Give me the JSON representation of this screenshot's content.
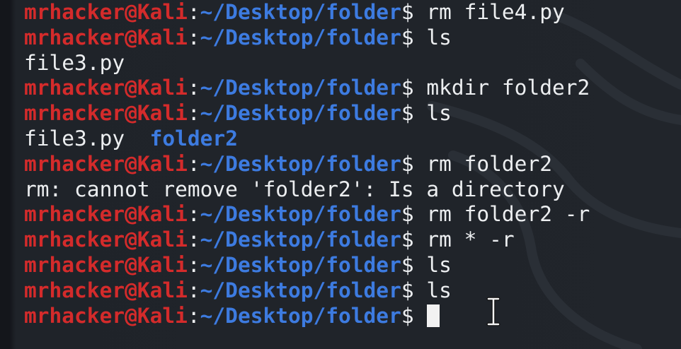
{
  "terminal": {
    "prompt": {
      "user_host": "mrhacker@Kali",
      "colon": ":",
      "path": "~/Desktop/folder",
      "dollar": "$"
    },
    "lines": [
      {
        "type": "prompt",
        "command": "rm file4.py"
      },
      {
        "type": "prompt",
        "command": "ls"
      },
      {
        "type": "output",
        "text": "file3.py"
      },
      {
        "type": "prompt",
        "command": "mkdir folder2"
      },
      {
        "type": "prompt",
        "command": "ls"
      },
      {
        "type": "listing",
        "file": "file3.py",
        "dir": "folder2"
      },
      {
        "type": "prompt",
        "command": "rm folder2"
      },
      {
        "type": "output",
        "text": "rm: cannot remove 'folder2': Is a directory"
      },
      {
        "type": "prompt",
        "command": "rm folder2 -r"
      },
      {
        "type": "prompt",
        "command": "rm * -r"
      },
      {
        "type": "prompt",
        "command": "ls"
      },
      {
        "type": "prompt",
        "command": "ls"
      },
      {
        "type": "current_prompt",
        "command": ""
      }
    ],
    "colors": {
      "background": "#21252b",
      "user_host": "#d42b2b",
      "path": "#3d7be0",
      "text": "#eceef0"
    },
    "icons": {
      "watermark": "kali-dragon-icon",
      "text_cursor": "ibeam-cursor-icon"
    }
  }
}
